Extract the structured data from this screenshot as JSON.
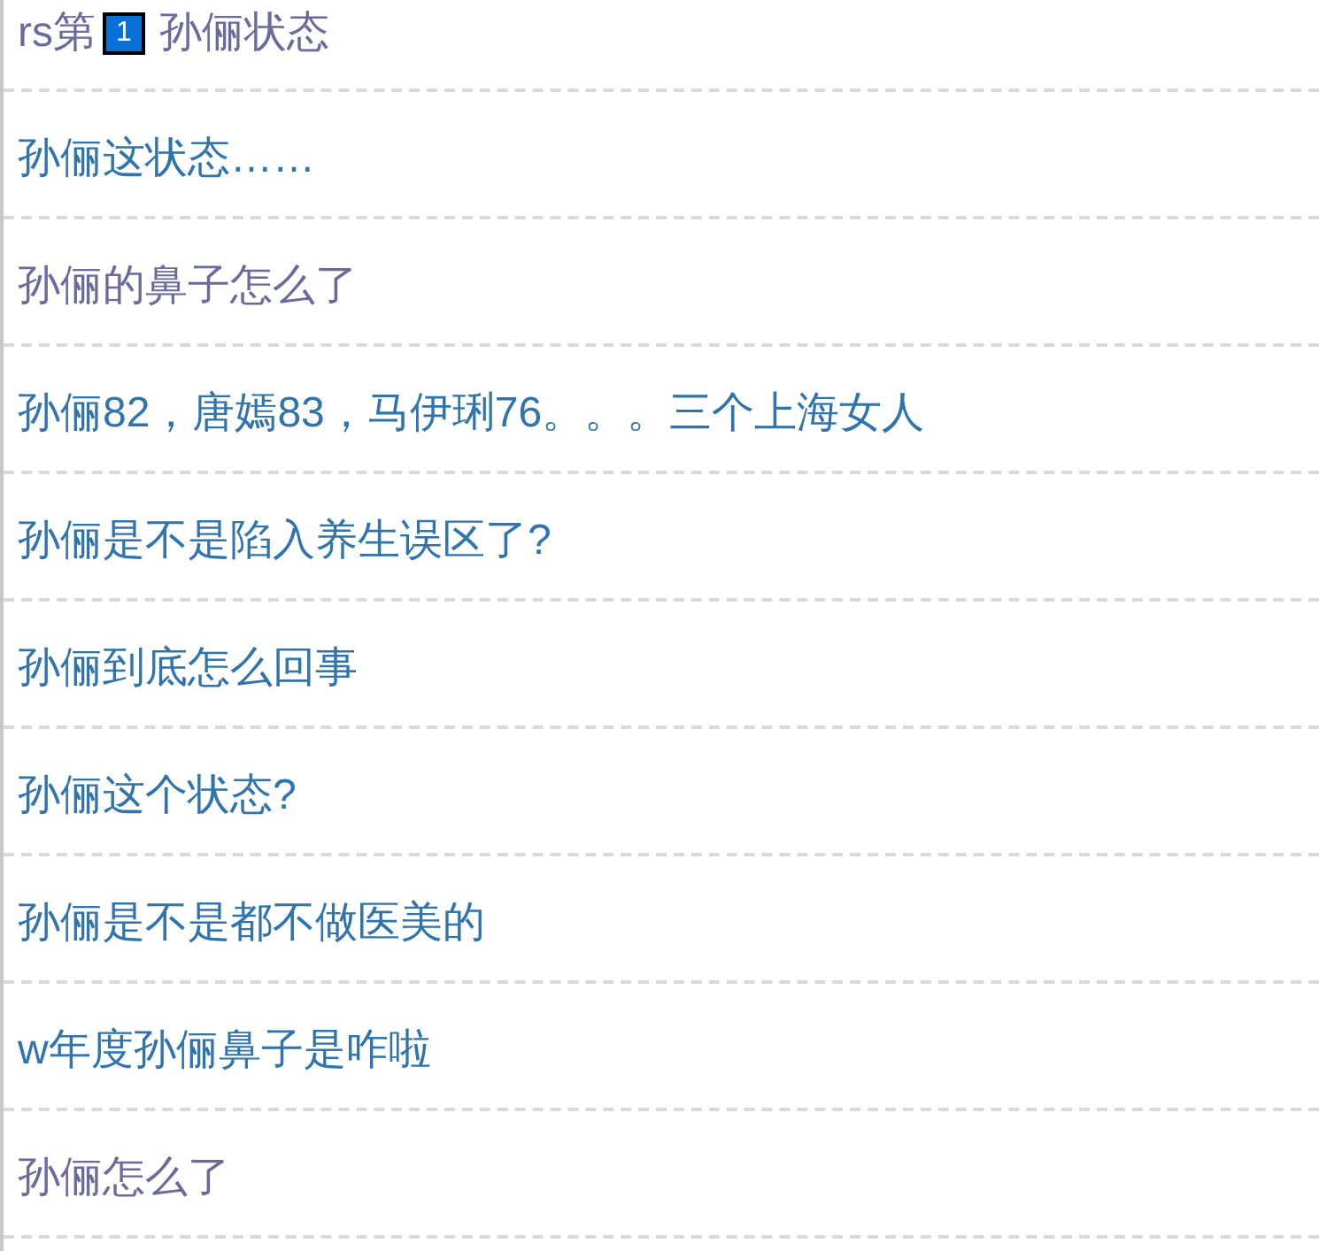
{
  "links": [
    {
      "prefix": "rs第",
      "badge": "1",
      "text": "孙俪状态",
      "visited": true
    },
    {
      "text": "孙俪这状态……",
      "visited": false
    },
    {
      "text": "孙俪的鼻子怎么了",
      "visited": true
    },
    {
      "text": "孙俪82，唐嫣83，马伊琍76。。。三个上海女人",
      "visited": false
    },
    {
      "text": "孙俪是不是陷入养生误区了?",
      "visited": false
    },
    {
      "text": "孙俪到底怎么回事",
      "visited": false
    },
    {
      "text": "孙俪这个状态?",
      "visited": false
    },
    {
      "text": "孙俪是不是都不做医美的",
      "visited": false
    },
    {
      "text": "w年度孙俪鼻子是咋啦",
      "visited": false
    },
    {
      "text": "孙俪怎么了",
      "visited": true
    }
  ]
}
